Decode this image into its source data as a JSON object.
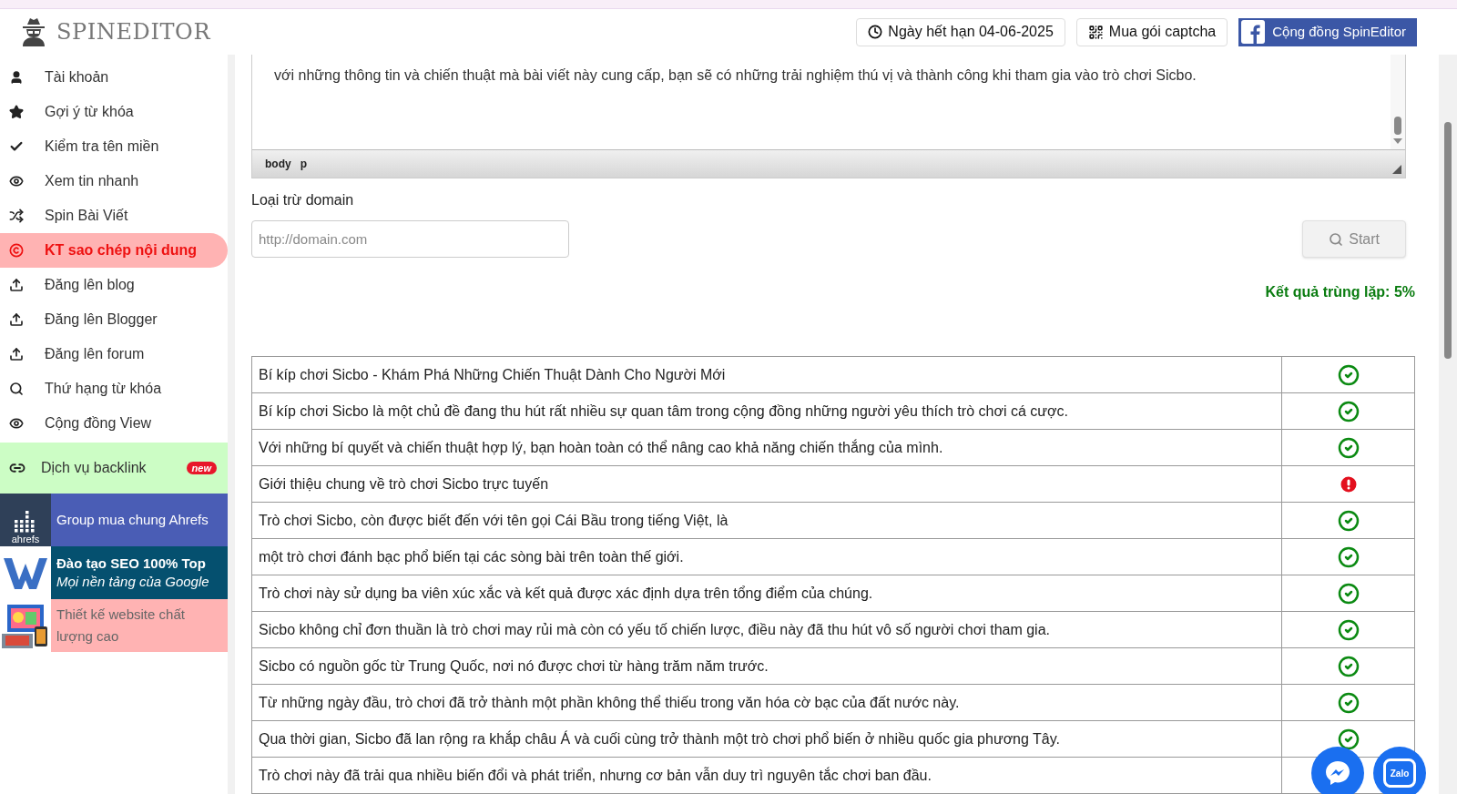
{
  "header": {
    "logo": "SPINEDITOR",
    "buttons": [
      {
        "kind": "expiry",
        "label": "Ngày hết hạn 04-06-2025"
      },
      {
        "kind": "captcha",
        "label": "Mua gói captcha"
      },
      {
        "kind": "facebook",
        "label": "Cộng đồng SpinEditor"
      }
    ]
  },
  "sidebar": {
    "items": [
      {
        "kind": "user",
        "label": "Tài khoản",
        "selected": false
      },
      {
        "kind": "star",
        "label": "Gợi ý từ khóa",
        "selected": false
      },
      {
        "kind": "check",
        "label": "Kiểm tra tên miền",
        "selected": false
      },
      {
        "kind": "eye",
        "label": "Xem tin nhanh",
        "selected": false
      },
      {
        "kind": "shuffle",
        "label": "Spin Bài Viết",
        "selected": false
      },
      {
        "kind": "copyright",
        "label": "KT sao chép nội dung",
        "selected": true
      },
      {
        "kind": "upload",
        "label": "Đăng lên blog",
        "selected": false
      },
      {
        "kind": "upload",
        "label": "Đăng lên Blogger",
        "selected": false
      },
      {
        "kind": "upload",
        "label": "Đăng lên forum",
        "selected": false
      },
      {
        "kind": "search",
        "label": "Thứ hạng từ khóa",
        "selected": false
      },
      {
        "kind": "eye",
        "label": "Cộng đồng View",
        "selected": false
      }
    ],
    "backlink": {
      "label": "Dịch vụ backlink",
      "badge": "new"
    },
    "promos": [
      {
        "kind": "ahrefs",
        "logo": "ahrefs",
        "title": "Group mua chung Ahrefs"
      },
      {
        "kind": "seo",
        "title": "Đào tạo SEO 100% Top",
        "subtitle": "Mọi nền tảng của Google"
      },
      {
        "kind": "web",
        "title": "Thiết kế website chất lượng cao"
      }
    ]
  },
  "editor": {
    "text": "với những thông tin và chiến thuật mà bài viết này cung cấp, bạn sẽ có những trải nghiệm thú vị và thành công khi tham gia vào trò chơi Sicbo.",
    "path": [
      "body",
      "p"
    ]
  },
  "exclude": {
    "label": "Loại trừ domain",
    "placeholder": "http://domain.com",
    "button": "Start"
  },
  "result": "Kết quả trùng lặp: 5%",
  "rows": [
    {
      "text": "Bí kíp chơi Sicbo - Khám Phá Những Chiến Thuật Dành Cho Người Mới",
      "duplicate": false
    },
    {
      "text": "Bí kíp chơi Sicbo là một chủ đề đang thu hút rất nhiều sự quan tâm trong cộng đồng những người yêu thích trò chơi cá cược.",
      "duplicate": false
    },
    {
      "text": "Với những bí quyết và chiến thuật hợp lý, bạn hoàn toàn có thể nâng cao khả năng chiến thắng của mình.",
      "duplicate": false
    },
    {
      "text": "Giới thiệu chung về trò chơi Sicbo trực tuyến",
      "duplicate": true
    },
    {
      "text": "Trò chơi Sicbo, còn được biết đến với tên gọi Cái Bầu trong tiếng Việt, là",
      "duplicate": false
    },
    {
      "text": "một trò chơi đánh bạc phổ biến tại các sòng bài trên toàn thế giới.",
      "duplicate": false
    },
    {
      "text": "Trò chơi này sử dụng ba viên xúc xắc và kết quả được xác định dựa trên tổng điểm của chúng.",
      "duplicate": false
    },
    {
      "text": "Sicbo không chỉ đơn thuần là trò chơi may rủi mà còn có yếu tố chiến lược, điều này đã thu hút vô số người chơi tham gia.",
      "duplicate": false
    },
    {
      "text": "Sicbo có nguồn gốc từ Trung Quốc, nơi nó được chơi từ hàng trăm năm trước.",
      "duplicate": false
    },
    {
      "text": "Từ những ngày đầu, trò chơi đã trở thành một phần không thể thiếu trong văn hóa cờ bạc của đất nước này.",
      "duplicate": false
    },
    {
      "text": "Qua thời gian, Sicbo đã lan rộng ra khắp châu Á và cuối cùng trở thành một trò chơi phổ biến ở nhiều quốc gia phương Tây.",
      "duplicate": false
    },
    {
      "text": "Trò chơi này đã trải qua nhiều biến đổi và phát triển, nhưng cơ bản vẫn duy trì nguyên tắc chơi ban đầu."
    }
  ],
  "chat": {
    "zalo": "Zalo"
  }
}
